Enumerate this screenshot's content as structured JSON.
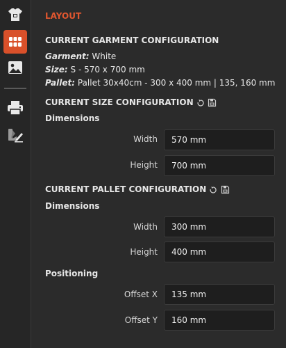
{
  "header": {
    "title": "LAYOUT"
  },
  "garment_config": {
    "title": "CURRENT GARMENT CONFIGURATION",
    "garment_label": "Garment:",
    "garment_value": "White",
    "size_label": "Size:",
    "size_value": "S - 570 x 700 mm",
    "pallet_label": "Pallet:",
    "pallet_value": "Pallet 30x40cm - 300 x 400 mm | 135, 160 mm"
  },
  "size_config": {
    "title": "CURRENT SIZE CONFIGURATION",
    "dimensions_label": "Dimensions",
    "width_label": "Width",
    "width_value": "570 mm",
    "height_label": "Height",
    "height_value": "700 mm"
  },
  "pallet_config": {
    "title": "CURRENT PALLET CONFIGURATION",
    "dimensions_label": "Dimensions",
    "width_label": "Width",
    "width_value": "300 mm",
    "height_label": "Height",
    "height_value": "400 mm",
    "positioning_label": "Positioning",
    "offset_x_label": "Offset X",
    "offset_x_value": "135 mm",
    "offset_y_label": "Offset Y",
    "offset_y_value": "160 mm"
  },
  "sidebar": {
    "items": [
      {
        "icon": "garment-icon"
      },
      {
        "icon": "grid-icon",
        "active": true
      },
      {
        "icon": "image-icon"
      },
      {
        "icon": "printer-icon"
      },
      {
        "icon": "color-edit-icon"
      }
    ]
  },
  "colors": {
    "accent": "#e0562f",
    "background": "#2b2b2b",
    "sidebar": "#262626",
    "input_bg": "#1e1e1e"
  }
}
